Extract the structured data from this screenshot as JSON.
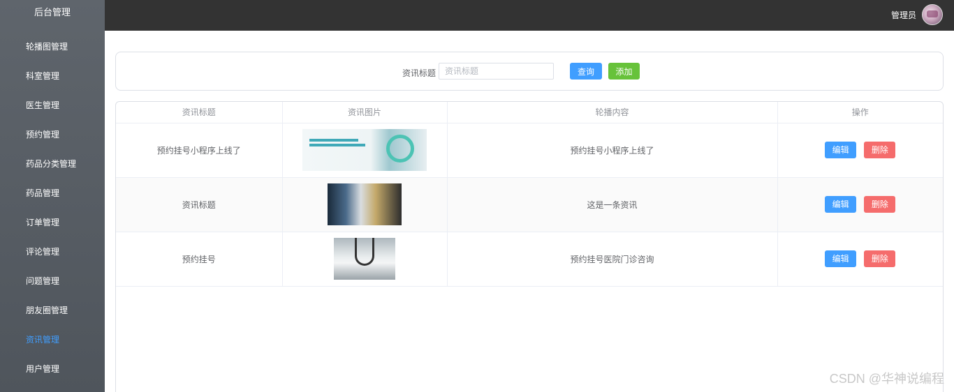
{
  "sidebar": {
    "brand": "后台管理",
    "items": [
      {
        "label": "轮播图管理"
      },
      {
        "label": "科室管理"
      },
      {
        "label": "医生管理"
      },
      {
        "label": "预约管理"
      },
      {
        "label": "药品分类管理"
      },
      {
        "label": "药品管理"
      },
      {
        "label": "订单管理"
      },
      {
        "label": "评论管理"
      },
      {
        "label": "问题管理"
      },
      {
        "label": "朋友圈管理"
      },
      {
        "label": "资讯管理",
        "active": true
      },
      {
        "label": "用户管理"
      }
    ]
  },
  "header": {
    "username": "管理员",
    "avatar_icon": "user-avatar"
  },
  "search": {
    "label": "资讯标题",
    "placeholder": "资讯标题",
    "value": "",
    "query_label": "查询",
    "add_label": "添加"
  },
  "table": {
    "columns": [
      "资讯标题",
      "资讯图片",
      "轮播内容",
      "操作"
    ],
    "rows": [
      {
        "title": "预约挂号小程序上线了",
        "image": "health-management-banner",
        "content": "预约挂号小程序上线了",
        "edit": "编辑",
        "delete": "删除"
      },
      {
        "title": "资讯标题",
        "image": "doctor-consultation-photo",
        "content": "这是一条资讯",
        "edit": "编辑",
        "delete": "删除"
      },
      {
        "title": "预约挂号",
        "image": "doctor-stethoscope-photo",
        "content": "预约挂号医院门诊咨询",
        "edit": "编辑",
        "delete": "删除"
      }
    ]
  },
  "watermark": "CSDN @华神说编程",
  "colors": {
    "primary": "#409eff",
    "success": "#67c23a",
    "danger": "#f56c6c",
    "header_bg": "#333333",
    "sidebar_bg": "#545c64",
    "active_menu": "#409eff"
  }
}
